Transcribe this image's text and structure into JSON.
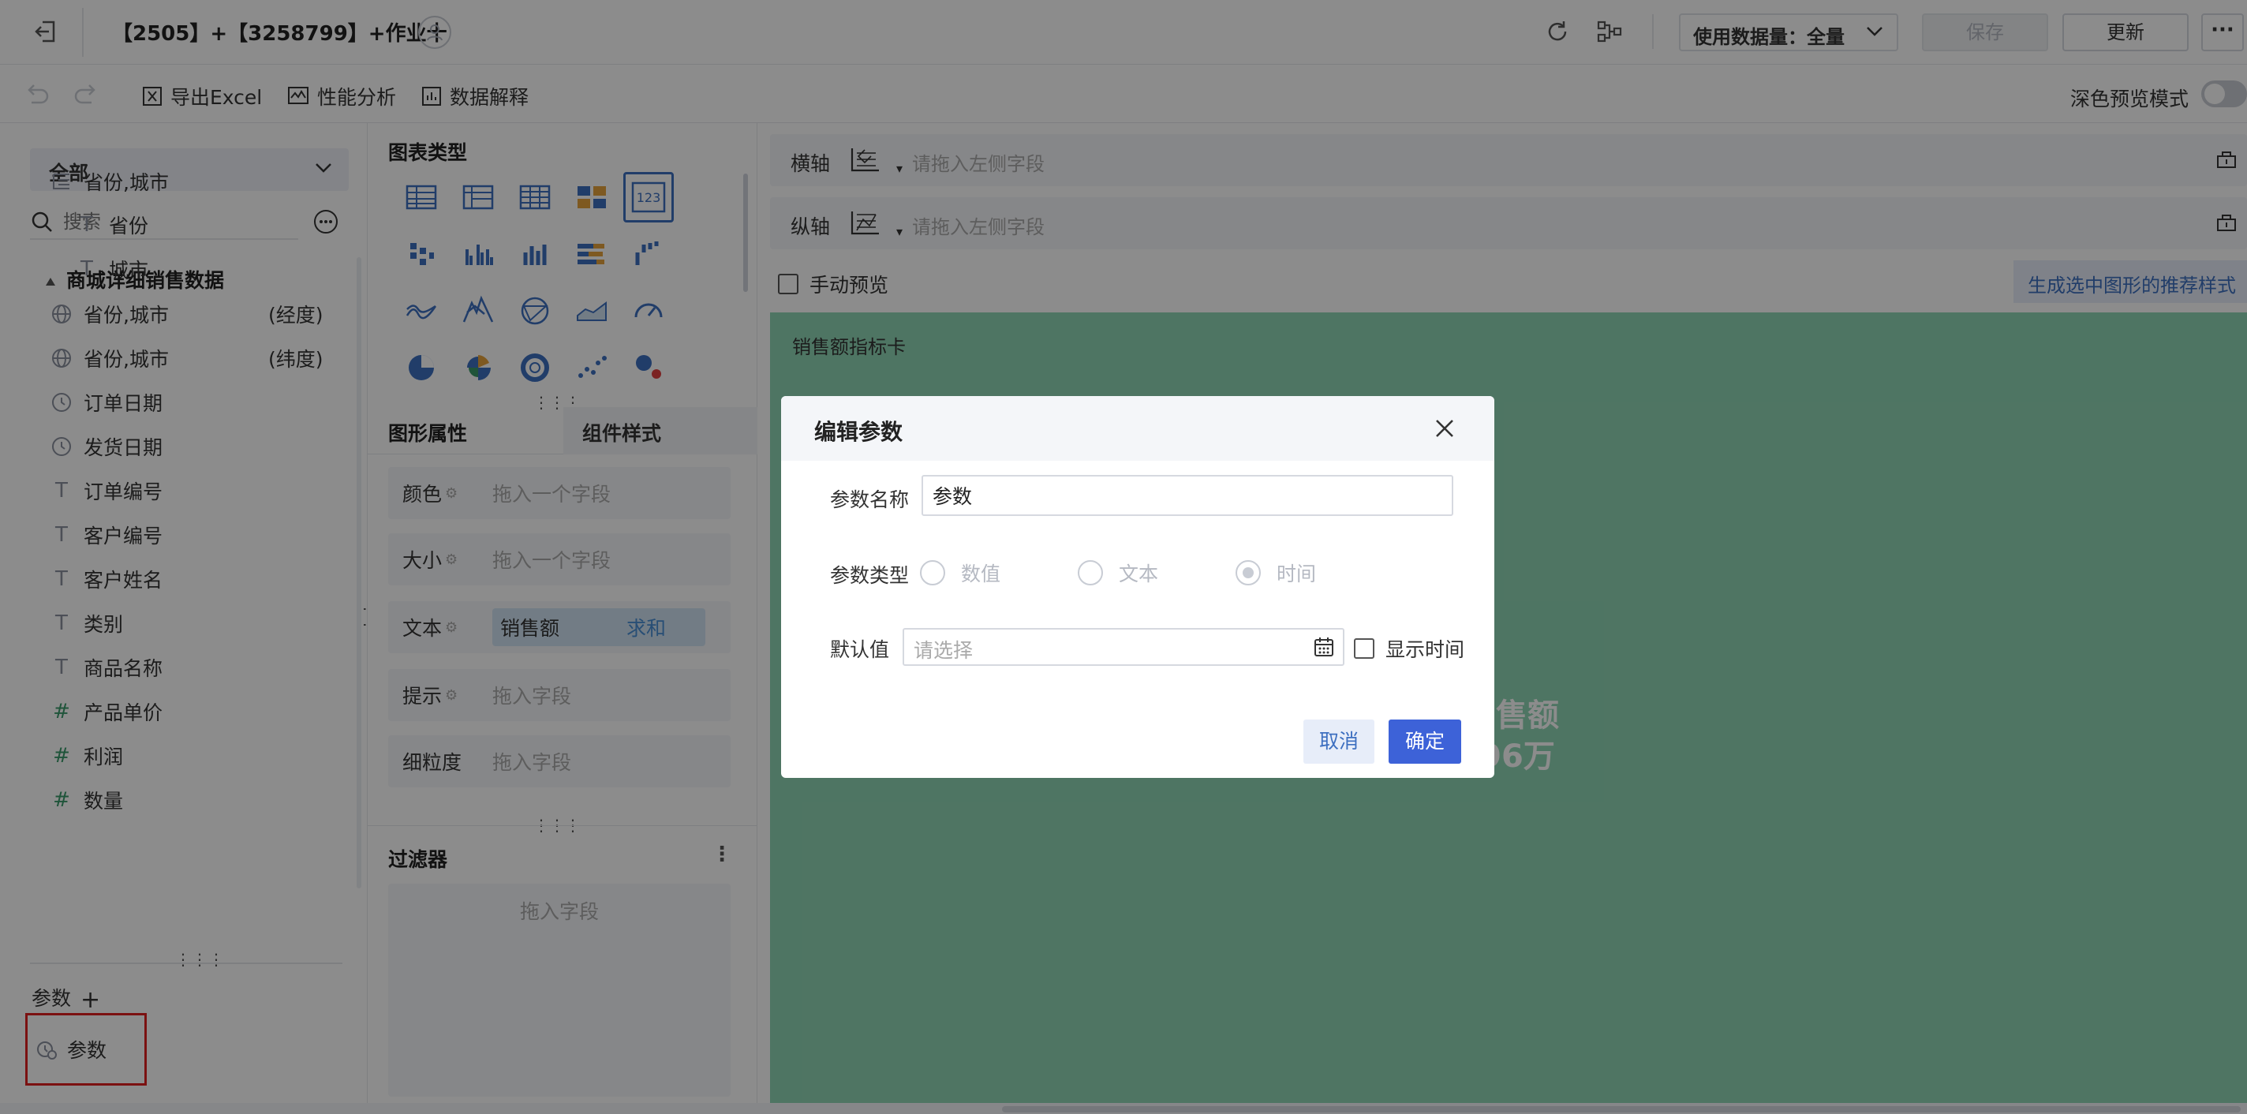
{
  "header": {
    "title": "【2505】+【3258799】+作业十",
    "usage_label": "使用数据量：全量",
    "save_label": "保存",
    "update_label": "更新",
    "more_label": "···"
  },
  "toolbar": {
    "export_label": "导出Excel",
    "perf_label": "性能分析",
    "explain_label": "数据解释",
    "dark_mode_label": "深色预览模式"
  },
  "left": {
    "scope": "全部",
    "search_placeholder": "搜索",
    "group_name": "商城详细销售数据",
    "fields": [
      {
        "label": "省份,城市",
        "icon": "hierarchy-icon"
      },
      {
        "label": "省份",
        "icon": "text-field-icon"
      },
      {
        "label": "城市",
        "icon": "text-field-icon"
      },
      {
        "label": "省份,城市",
        "icon": "globe-icon",
        "suffix": "(经度)"
      },
      {
        "label": "省份,城市",
        "icon": "globe-icon",
        "suffix": "(纬度)"
      },
      {
        "label": "订单日期",
        "icon": "clock-icon"
      },
      {
        "label": "发货日期",
        "icon": "clock-icon"
      },
      {
        "label": "订单编号",
        "icon": "text-field-icon"
      },
      {
        "label": "客户编号",
        "icon": "text-field-icon"
      },
      {
        "label": "客户姓名",
        "icon": "text-field-icon"
      },
      {
        "label": "类别",
        "icon": "text-field-icon"
      },
      {
        "label": "商品名称",
        "icon": "text-field-icon"
      },
      {
        "label": "产品单价",
        "icon": "number-field-icon"
      },
      {
        "label": "利润",
        "icon": "number-field-icon"
      },
      {
        "label": "数量",
        "icon": "number-field-icon"
      }
    ],
    "params_label": "参数",
    "param_item": "参数"
  },
  "middle": {
    "chart_types_label": "图表类型",
    "chart_types": [
      "detail-table",
      "group-table",
      "cross-table",
      "card-layout",
      "kpi-card",
      "scatter-bars",
      "grouped-bar",
      "bar",
      "stacked-bar",
      "waterfall",
      "line",
      "multi-line",
      "radar",
      "area",
      "gauge",
      "pie",
      "rose-pie",
      "ring",
      "scatter",
      "bubble"
    ],
    "tab_graph_props": "图形属性",
    "tab_component_style": "组件样式",
    "props": [
      {
        "label": "颜色",
        "placeholder": "拖入一个字段"
      },
      {
        "label": "大小",
        "placeholder": "拖入一个字段"
      },
      {
        "label": "文本",
        "chip": "销售额",
        "agg": "求和"
      },
      {
        "label": "提示",
        "placeholder": "拖入字段"
      },
      {
        "label": "细粒度",
        "placeholder": "拖入字段"
      }
    ],
    "filter_label": "过滤器",
    "filter_placeholder": "拖入字段"
  },
  "right": {
    "x_axis_label": "横轴",
    "y_axis_label": "纵轴",
    "axis_placeholder": "请拖入左侧字段",
    "manual_preview_label": "手动预览",
    "recommend_label": "生成选中图形的推荐样式",
    "card_title": "销售额指标卡",
    "metric_name": "售额",
    "metric_value": ".96万"
  },
  "modal": {
    "title": "编辑参数",
    "name_label": "参数名称",
    "name_value": "参数",
    "type_label": "参数类型",
    "type_options": [
      "数值",
      "文本",
      "时间"
    ],
    "type_selected": "时间",
    "default_label": "默认值",
    "default_placeholder": "请选择",
    "show_time_label": "显示时间",
    "cancel_label": "取消",
    "ok_label": "确定"
  },
  "colors": {
    "accent": "#3d62d8",
    "canvas_bg": "#8fd6b4",
    "highlight_border": "#e02020",
    "selected_chart_type": "#3d6fc0"
  }
}
